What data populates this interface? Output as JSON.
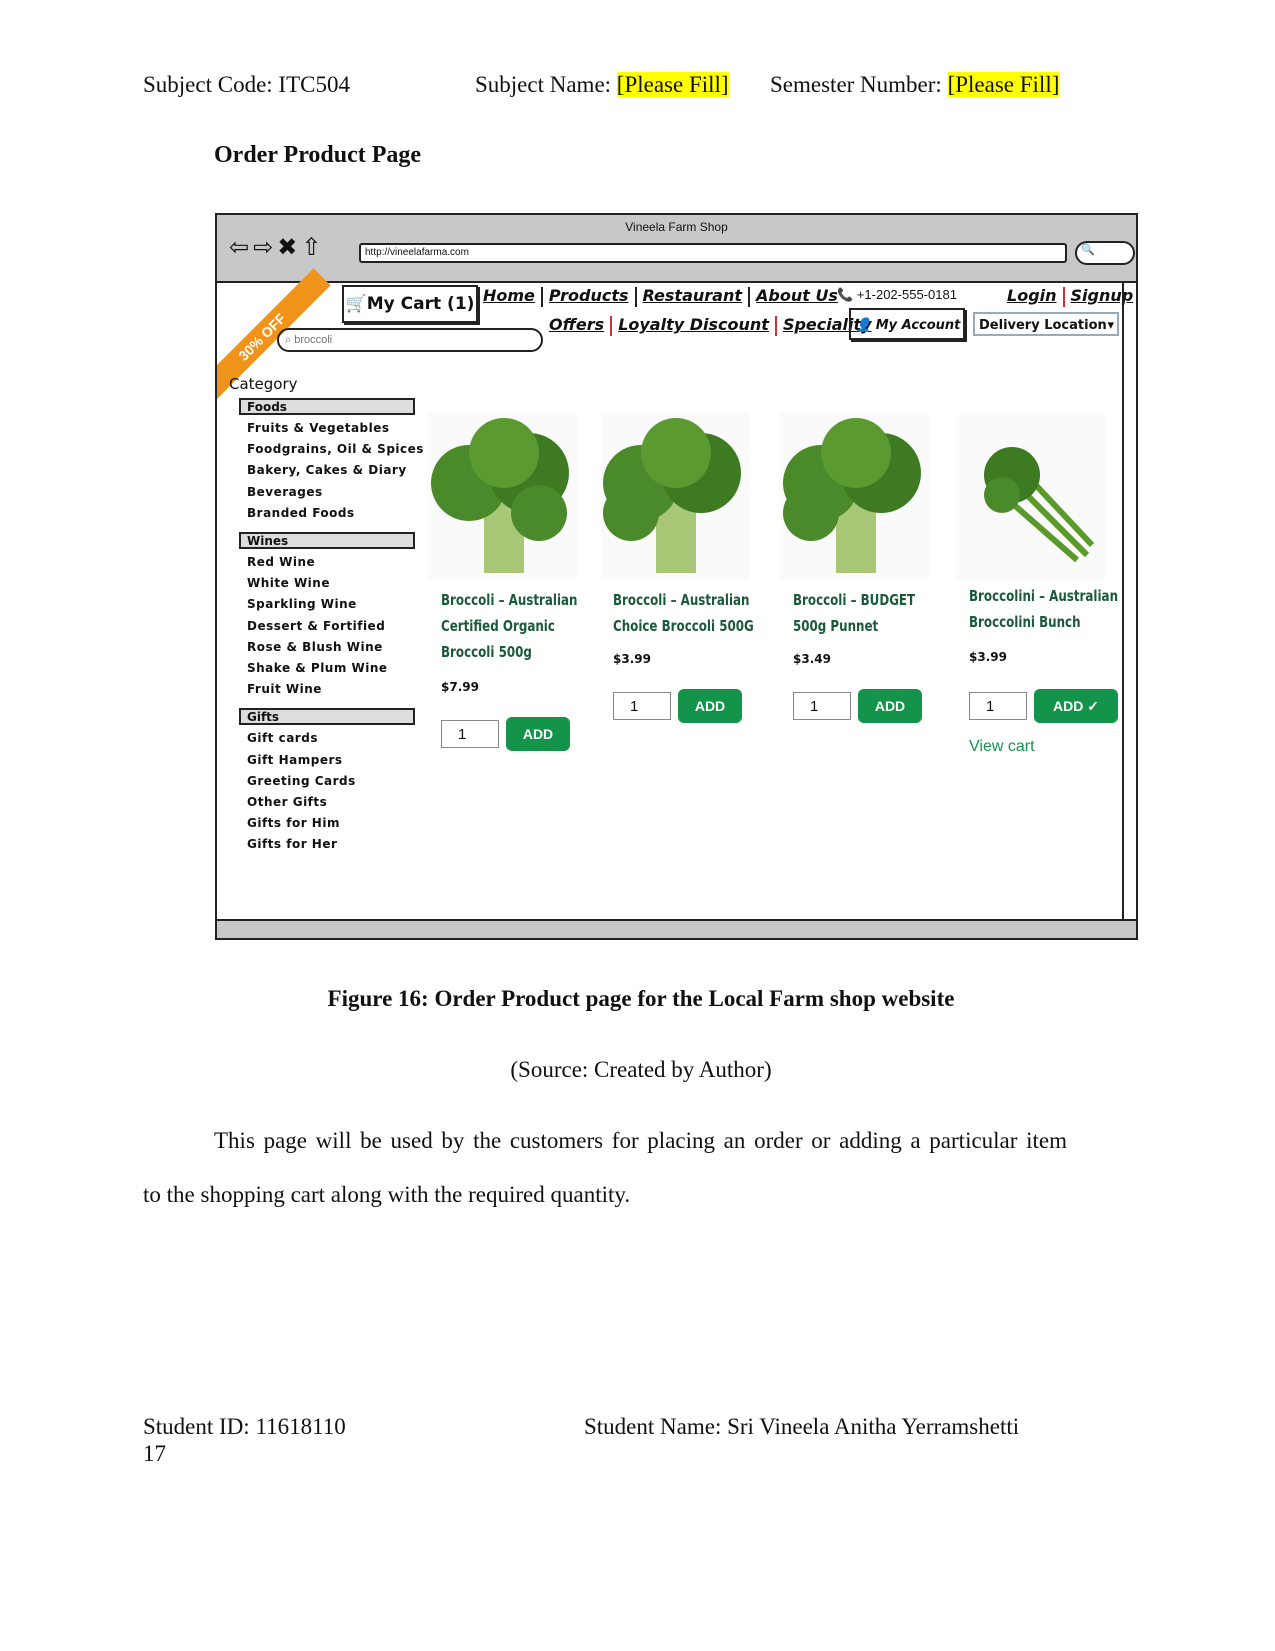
{
  "header": {
    "subject_code": "Subject Code: ITC504",
    "subject_name_label": "Subject Name: ",
    "subject_name_value": "[Please Fill]",
    "semester_label": "Semester Number: ",
    "semester_value": "[Please Fill]"
  },
  "section_title": "Order Product Page",
  "wireframe": {
    "window_title": "Vineela Farm Shop",
    "url": "http://vineelafarma.com",
    "ribbon": "30% OFF",
    "cart": "My Cart (1)",
    "search_value": "broccoli",
    "nav_row1": [
      "Home",
      "Products",
      "Restaurant",
      "About Us"
    ],
    "phone": "+1-202-555-0181",
    "login": "Login",
    "signup": "Signup",
    "nav_row2": [
      "Offers",
      "Loyalty Discount",
      "Speciality"
    ],
    "my_account": "My Account",
    "delivery": "Delivery Location",
    "category_title": "Category",
    "categories": [
      {
        "head": "Foods",
        "items": [
          "Fruits & Vegetables",
          "Foodgrains, Oil & Spices",
          "Bakery, Cakes & Diary",
          "Beverages",
          "Branded Foods"
        ]
      },
      {
        "head": "Wines",
        "items": [
          "Red Wine",
          "White Wine",
          "Sparkling Wine",
          "Dessert & Fortified",
          "Rose & Blush Wine",
          "Shake & Plum Wine",
          "Fruit Wine"
        ]
      },
      {
        "head": "Gifts",
        "items": [
          "Gift cards",
          "Gift Hampers",
          "Greeting Cards",
          "Other Gifts",
          "Gifts for Him",
          "Gifts for Her"
        ]
      }
    ],
    "products": [
      {
        "name": "Broccoli – Australian Certified Organic Broccoli 500g",
        "price": "$7.99",
        "qty": "1",
        "button": "ADD"
      },
      {
        "name": "Broccoli – Australian Choice Broccoli 500G",
        "price": "$3.99",
        "qty": "1",
        "button": "ADD"
      },
      {
        "name": "Broccoli – BUDGET 500g Punnet",
        "price": "$3.49",
        "qty": "1",
        "button": "ADD"
      },
      {
        "name": "Broccolini – Australian Broccolini Bunch",
        "price": "$3.99",
        "qty": "1",
        "button": "ADD ✓",
        "link": "View cart"
      }
    ],
    "accent": "#14934a"
  },
  "caption": "Figure 16: Order Product page for the Local Farm shop website",
  "source": "(Source: Created by Author)",
  "body_line1": "This page will be used by the customers for placing an order or adding a particular item",
  "body_line2": "to the shopping cart along with the required quantity.",
  "footer": {
    "student_id": "Student  ID:  11618110",
    "student_name": "Student  Name:  Sri  Vineela  Anitha  Yerramshetti",
    "page_number": "17"
  }
}
